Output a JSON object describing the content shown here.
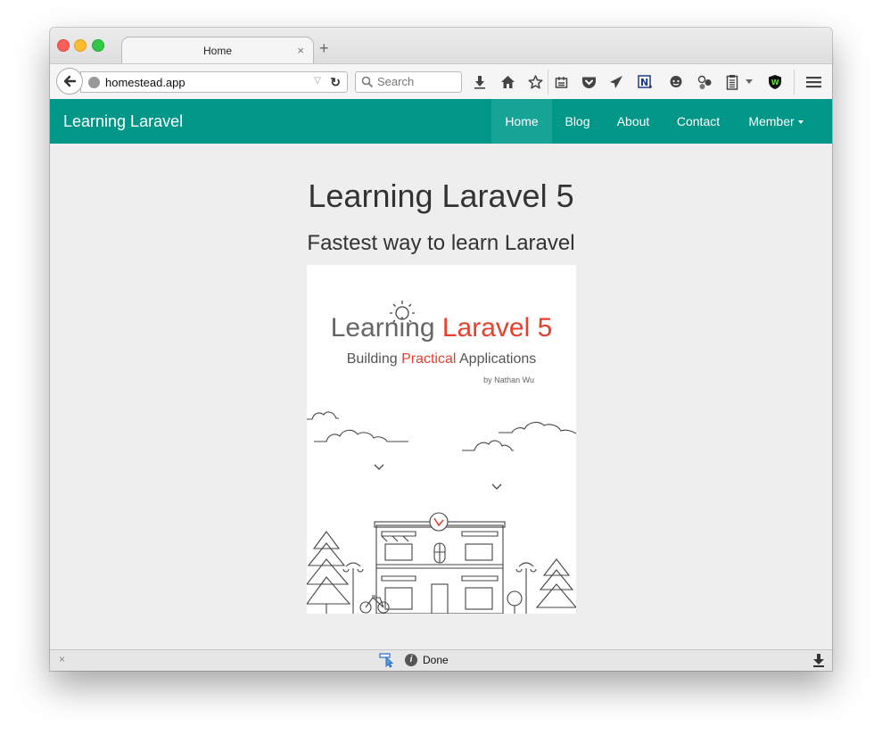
{
  "browser": {
    "tab_title": "Home",
    "tab_close": "×",
    "new_tab": "+",
    "url": "homestead.app",
    "search_placeholder": "Search",
    "toolbar_icons": [
      "download-icon",
      "home-icon",
      "bookmark-star-icon",
      "reading-list-icon",
      "pocket-icon",
      "send-icon",
      "notes-icon",
      "chat-icon",
      "extension-icon",
      "clipboard-icon",
      "dropdown-icon",
      "shield-icon",
      "hamburger-menu-icon"
    ]
  },
  "navbar": {
    "brand": "Learning Laravel",
    "items": [
      {
        "label": "Home",
        "active": true
      },
      {
        "label": "Blog"
      },
      {
        "label": "About"
      },
      {
        "label": "Contact"
      },
      {
        "label": "Member",
        "dropdown": true
      }
    ],
    "color": "#009688"
  },
  "main": {
    "title": "Learning Laravel 5",
    "subtitle": "Fastest way to learn Laravel",
    "cover": {
      "title_part1": "Learning ",
      "title_part2": "Laravel 5",
      "subtitle_part1": "Building ",
      "subtitle_part2": "Practical",
      "subtitle_part3": " Applications",
      "author": "by Nathan Wu",
      "accent": "#e7402d"
    }
  },
  "statusbar": {
    "close": "×",
    "status": "Done",
    "info": "i"
  }
}
